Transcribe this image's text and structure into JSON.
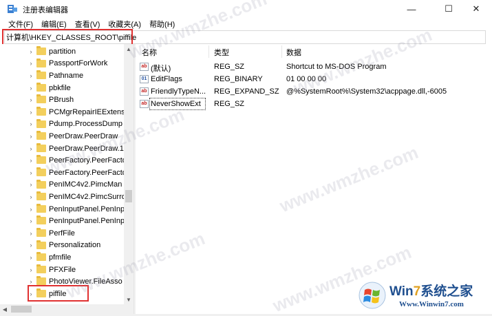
{
  "window": {
    "title": "注册表编辑器",
    "min_glyph": "—",
    "max_glyph": "☐",
    "close_glyph": "✕"
  },
  "menu": [
    {
      "label": "文件(F)"
    },
    {
      "label": "编辑(E)"
    },
    {
      "label": "查看(V)"
    },
    {
      "label": "收藏夹(A)"
    },
    {
      "label": "帮助(H)"
    }
  ],
  "address": {
    "path": "计算机\\HKEY_CLASSES_ROOT\\piffile"
  },
  "tree": {
    "chevron_glyph": "›",
    "items": [
      {
        "label": "partition"
      },
      {
        "label": "PassportForWork"
      },
      {
        "label": "Pathname"
      },
      {
        "label": "pbkfile"
      },
      {
        "label": "PBrush"
      },
      {
        "label": "PCMgrRepairIEExtens"
      },
      {
        "label": "Pdump.ProcessDump"
      },
      {
        "label": "PeerDraw.PeerDraw"
      },
      {
        "label": "PeerDraw.PeerDraw.1"
      },
      {
        "label": "PeerFactory.PeerFacto"
      },
      {
        "label": "PeerFactory.PeerFacto"
      },
      {
        "label": "PenIMC4v2.PimcMan"
      },
      {
        "label": "PenIMC4v2.PimcSurro"
      },
      {
        "label": "PenInputPanel.PenInp"
      },
      {
        "label": "PenInputPanel.PenInp"
      },
      {
        "label": "PerfFile"
      },
      {
        "label": "Personalization"
      },
      {
        "label": "pfmfile"
      },
      {
        "label": "PFXFile"
      },
      {
        "label": "PhotoViewer.FileAsso"
      },
      {
        "label": "piffile"
      }
    ],
    "selected_item": "piffile"
  },
  "values_list": {
    "columns": {
      "name": "名称",
      "type": "类型",
      "data": "数据"
    },
    "rows": [
      {
        "icon": "string-value-icon",
        "icon_text": "ab",
        "name": "(默认)",
        "type": "REG_SZ",
        "data": "Shortcut to MS-DOS Program"
      },
      {
        "icon": "binary-value-icon",
        "icon_text": "01",
        "name": "EditFlags",
        "type": "REG_BINARY",
        "data": "01 00 00 00"
      },
      {
        "icon": "string-value-icon",
        "icon_text": "ab",
        "name": "FriendlyTypeN...",
        "type": "REG_EXPAND_SZ",
        "data": "@%SystemRoot%\\System32\\acppage.dll,-6005"
      },
      {
        "icon": "string-value-icon",
        "icon_text": "ab",
        "name": "NeverShowExt",
        "type": "REG_SZ",
        "data": ""
      }
    ]
  },
  "watermarks": [
    "www.wmzhe.com",
    "www.wmzhe.com",
    "www.wmzhe.com",
    "www.wmzhe.com",
    "www.wmzhe.com",
    "www.wmzhe.com"
  ],
  "brand": {
    "name_prefix": "Win",
    "name_seven": "7",
    "name_suffix": "系统之家",
    "url": "Www.Winwin7.com"
  },
  "colors": {
    "highlight_red": "#e03030",
    "folder_yellow": "#f3cf5d",
    "brand_blue": "#1f4f8f"
  }
}
